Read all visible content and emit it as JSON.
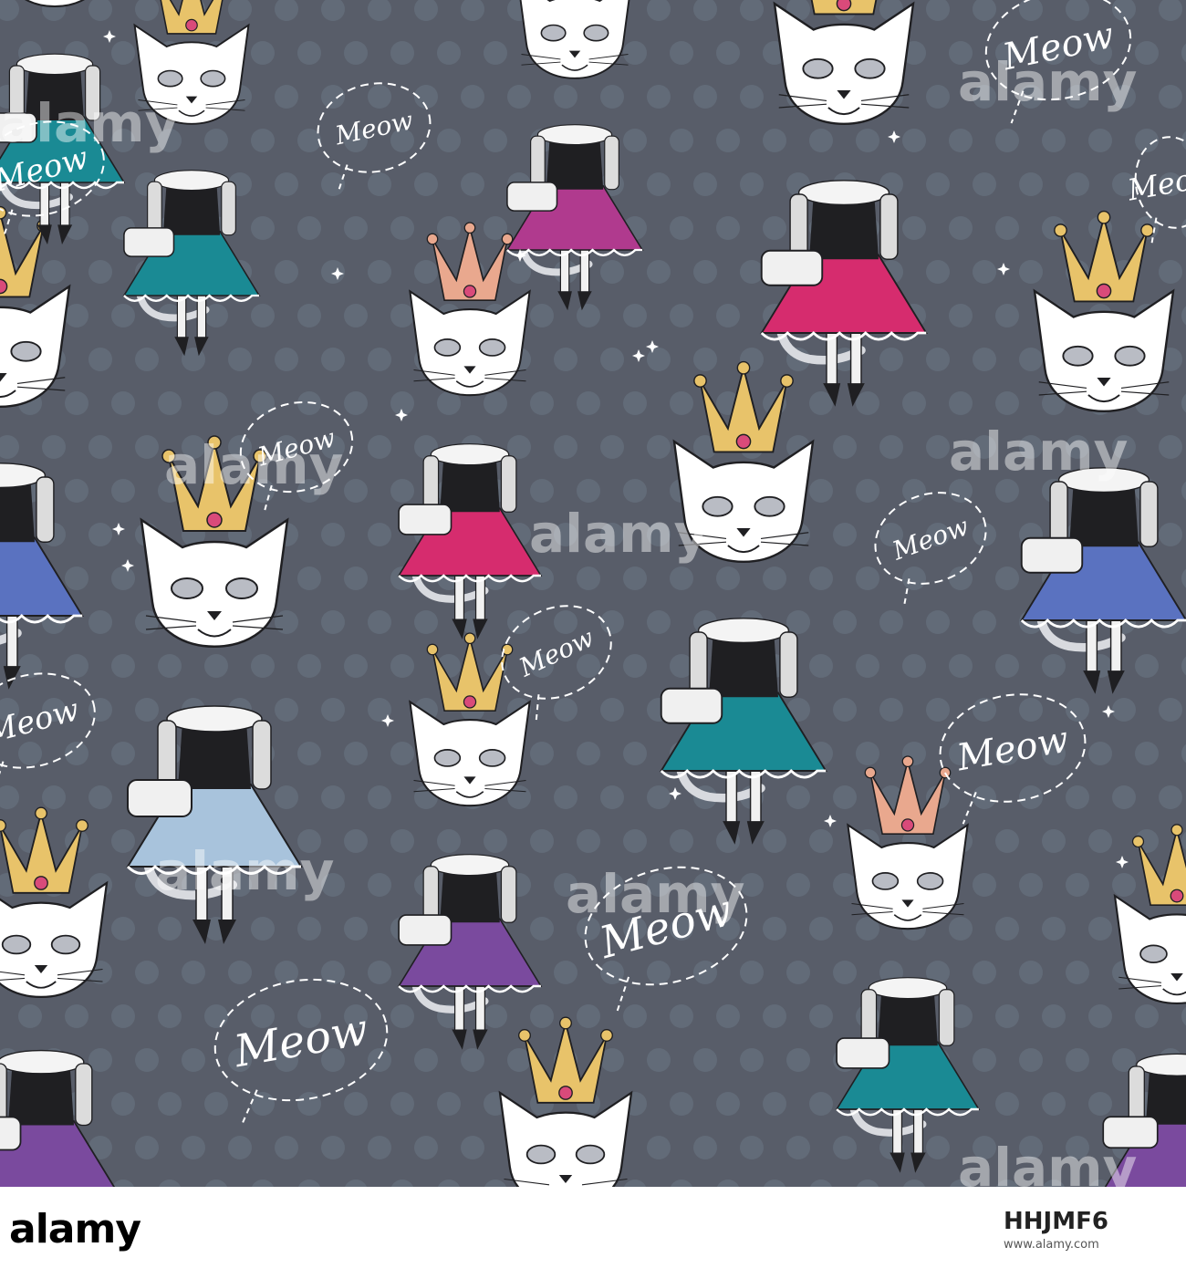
{
  "bubble_text": "Meow",
  "watermark_text": "alamy",
  "colors": {
    "background": "#585d69",
    "dot": "#66707d",
    "cat_face": "#ffffff",
    "line": "#1f1f22",
    "crown_gold": "#e8c36a",
    "crown_pink": "#e9a88e",
    "skirt_teal": "#1a8a94",
    "skirt_magenta": "#b03a8e",
    "skirt_pink": "#d62c6e",
    "skirt_lightblue": "#a8c3dc",
    "skirt_purple": "#7a4a9e",
    "skirt_blue": "#5a72c0",
    "footer_bg": "#ffffff"
  },
  "footer": {
    "logo": "alamy",
    "image_id": "HHJMF6",
    "meta": "www.alamy.com"
  }
}
